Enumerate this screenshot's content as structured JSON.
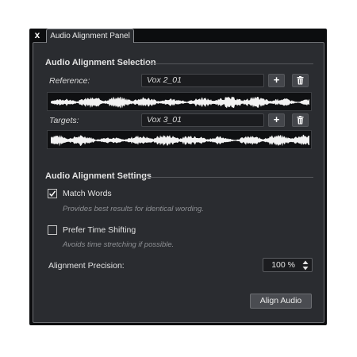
{
  "window": {
    "close_label": "x",
    "tab_label": "Audio Alignment Panel"
  },
  "selection": {
    "title": "Audio Alignment Selection",
    "reference_label": "Reference:",
    "reference_value": "Vox 2_01",
    "targets_label": "Targets:",
    "targets_value": "Vox 3_01",
    "add_label": "+"
  },
  "settings": {
    "title": "Audio Alignment Settings",
    "match_words": {
      "label": "Match Words",
      "checked": true,
      "hint": "Provides best results for identical wording."
    },
    "prefer_time_shifting": {
      "label": "Prefer Time Shifting",
      "checked": false,
      "hint": "Avoids time stretching if possible."
    },
    "precision_label": "Alignment Precision:",
    "precision_value": "100 %",
    "align_button_label": "Align Audio"
  },
  "icons": {
    "close": "close-icon",
    "add": "plus-icon",
    "delete": "trash-icon",
    "stepper": "up-down-arrows-icon",
    "check": "checkmark-icon"
  }
}
